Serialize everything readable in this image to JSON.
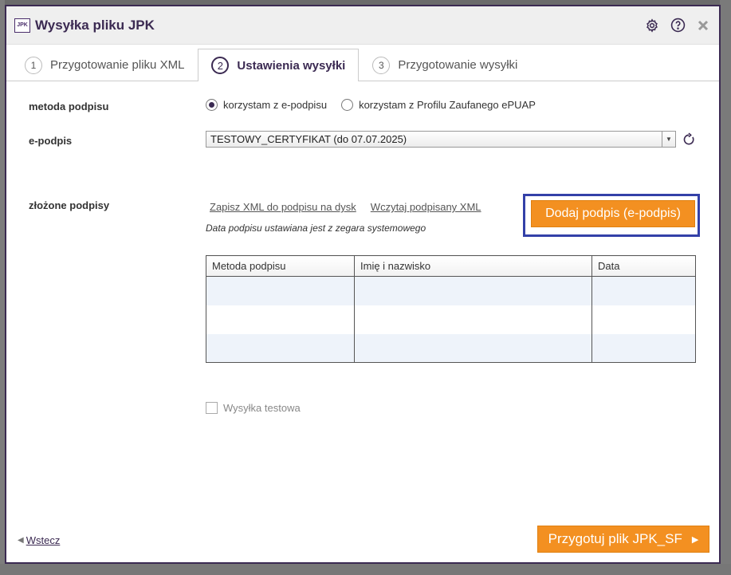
{
  "window": {
    "title": "Wysyłka pliku JPK",
    "logo_text": "JPK"
  },
  "title_icons": [
    "gear-icon",
    "help-icon",
    "close-icon"
  ],
  "tabs": [
    {
      "num": "1",
      "label": "Przygotowanie pliku XML",
      "active": false
    },
    {
      "num": "2",
      "label": "Ustawienia wysyłki",
      "active": true
    },
    {
      "num": "3",
      "label": "Przygotowanie wysyłki",
      "active": false
    }
  ],
  "form": {
    "method_label": "metoda podpisu",
    "radio_epodpis": "korzystam z e-podpisu",
    "radio_epuap": "korzystam z Profilu Zaufanego ePUAP",
    "selected_method": "korzystam z e-podpisu",
    "epodpis_label": "e-podpis",
    "epodpis_value": "TESTOWY_CERTYFIKAT (do 07.07.2025)",
    "signatures_label": "złożone podpisy",
    "link_save": "Zapisz XML do podpisu na dysk",
    "link_load": "Wczytaj podpisany XML",
    "note": "Data podpisu ustawiana jest z zegara systemowego",
    "add_signature_button": "Dodaj podpis (e-podpis)",
    "table_headers": [
      "Metoda podpisu",
      "Imię i nazwisko",
      "Data"
    ],
    "table_rows": [
      [
        "",
        "",
        ""
      ],
      [
        "",
        "",
        ""
      ],
      [
        "",
        "",
        ""
      ]
    ],
    "test_checkbox_label": "Wysyłka testowa",
    "test_checkbox_checked": false
  },
  "footer": {
    "back_label": "Wstecz",
    "next_label": "Przygotuj plik JPK_SF"
  },
  "colors": {
    "accent": "#3b2a52",
    "button": "#f39021",
    "highlight": "#3340a8"
  }
}
